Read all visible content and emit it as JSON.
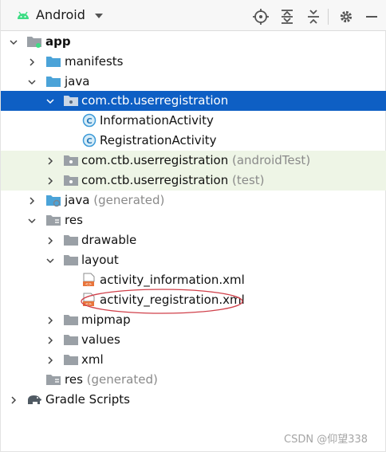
{
  "toolbar": {
    "title": "Android",
    "icons": [
      "android-icon",
      "dropdown-caret-icon",
      "crosshair-icon",
      "expand-all-icon",
      "collapse-all-icon",
      "gear-icon",
      "hide-icon"
    ]
  },
  "tree": {
    "app": "app",
    "manifests": "manifests",
    "java": "java",
    "pkg_main": "com.ctb.userregistration",
    "info_activity": "InformationActivity",
    "reg_activity": "RegistrationActivity",
    "pkg_android_test": "com.ctb.userregistration",
    "pkg_android_test_hint": "(androidTest)",
    "pkg_test": "com.ctb.userregistration",
    "pkg_test_hint": "(test)",
    "java_generated": "java",
    "java_generated_hint": "(generated)",
    "res": "res",
    "drawable": "drawable",
    "layout": "layout",
    "activity_information": "activity_information.xml",
    "activity_registration": "activity_registration.xml",
    "mipmap": "mipmap",
    "values": "values",
    "xml": "xml",
    "res_generated": "res",
    "res_generated_hint": "(generated)",
    "gradle_scripts": "Gradle Scripts"
  },
  "watermark": "CSDN @仰望338",
  "colors": {
    "selection": "#0e5fc4",
    "test_background": "#eef5e6",
    "folder_blue": "#4ba3d8",
    "folder_gray": "#9aa0a6",
    "class_badge": "#3d9ad8",
    "annotation_red": "#d0404a",
    "android_green": "#3ddc84"
  }
}
